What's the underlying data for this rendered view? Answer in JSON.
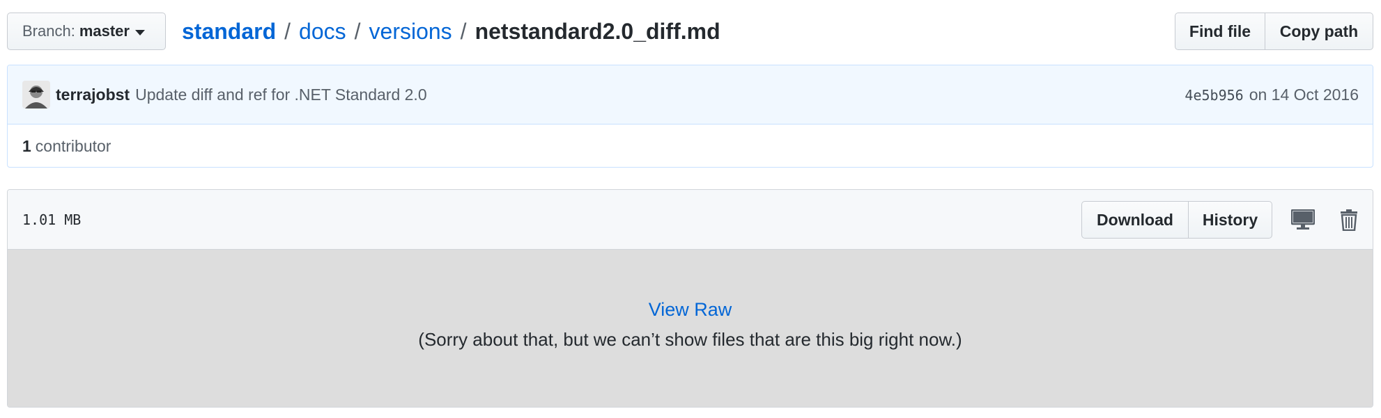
{
  "branch": {
    "prefix": "Branch:",
    "name": "master"
  },
  "breadcrumb": {
    "items": [
      "standard",
      "docs",
      "versions"
    ],
    "separator": "/",
    "current": "netstandard2.0_diff.md"
  },
  "file_nav": {
    "find_file": "Find file",
    "copy_path": "Copy path"
  },
  "commit": {
    "author": "terrajobst",
    "message": "Update diff and ref for .NET Standard 2.0",
    "sha": "4e5b956",
    "date_text": "on 14 Oct 2016",
    "avatar_icon": "user-avatar"
  },
  "contributors": {
    "count": "1",
    "label": "contributor"
  },
  "file": {
    "size": "1.01 MB",
    "download": "Download",
    "history": "History",
    "desktop_icon": "desktop-icon",
    "delete_icon": "trash-icon",
    "view_raw": "View Raw",
    "too_big": "(Sorry about that, but we can’t show files that are this big right now.)"
  },
  "colors": {
    "link": "#0366d6",
    "commit_bg": "#f1f8ff",
    "commit_border": "#c8e1ff",
    "file_body_bg": "#dddddd"
  }
}
